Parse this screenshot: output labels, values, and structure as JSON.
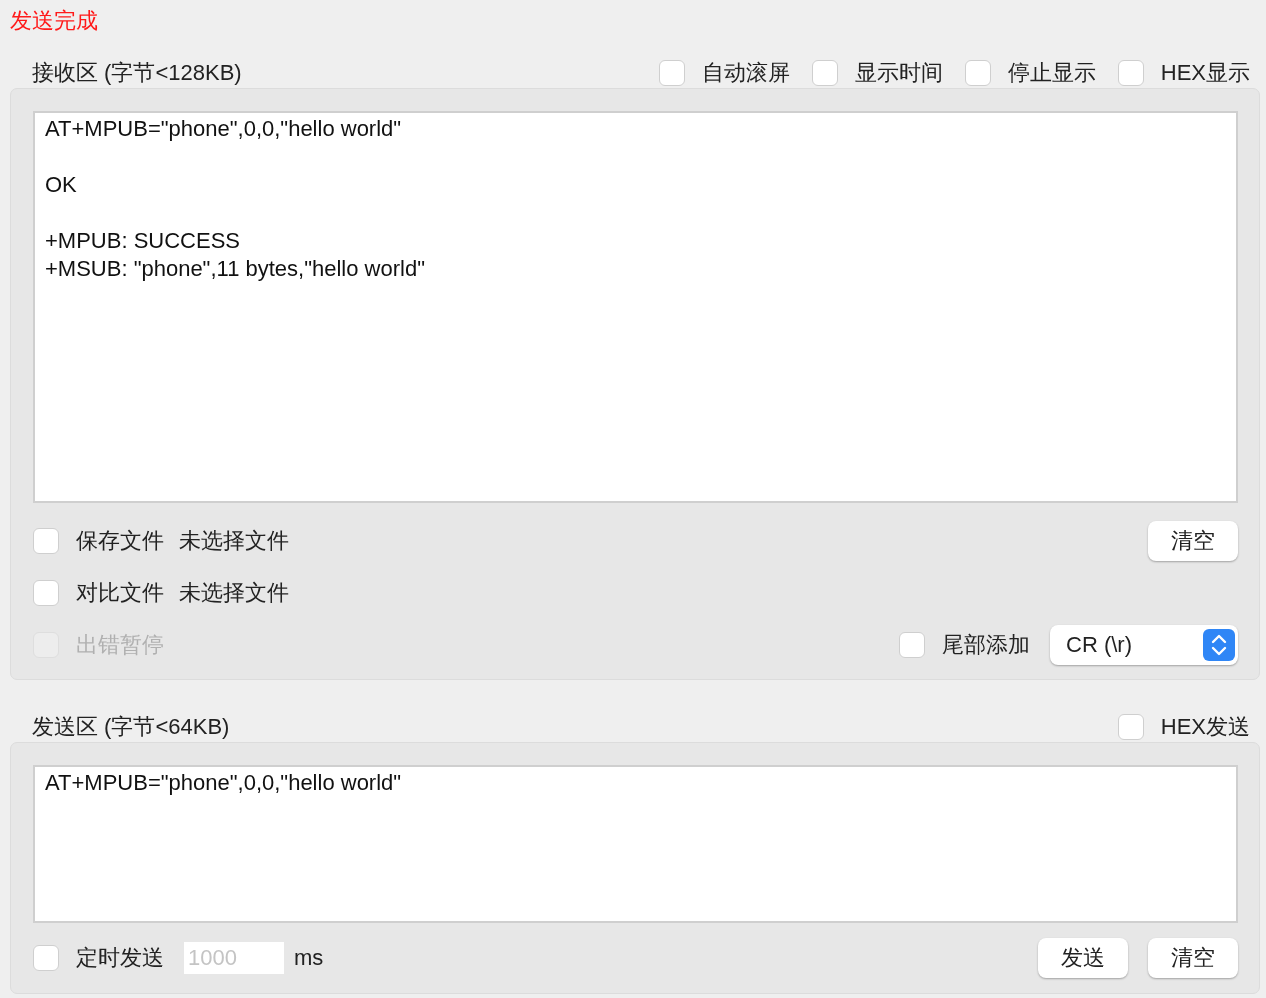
{
  "status": {
    "text": "发送完成"
  },
  "receive": {
    "title": "接收区 (字节<128KB)",
    "options": [
      {
        "label": "自动滚屏",
        "checked": false
      },
      {
        "label": "显示时间",
        "checked": false
      },
      {
        "label": "停止显示",
        "checked": false
      },
      {
        "label": "HEX显示",
        "checked": false
      }
    ],
    "content": "AT+MPUB=\"phone\",0,0,\"hello world\"\n\nOK\n\n+MPUB: SUCCESS\n+MSUB: \"phone\",11 bytes,\"hello world\"",
    "file_rows": [
      {
        "label": "保存文件",
        "file": "未选择文件",
        "checked": false,
        "disabled": false
      },
      {
        "label": "对比文件",
        "file": "未选择文件",
        "checked": false,
        "disabled": false
      },
      {
        "label": "出错暂停",
        "checked": false,
        "disabled": true
      }
    ],
    "clear_button": "清空",
    "append": {
      "label": "尾部添加",
      "checked": false
    },
    "line_ending": {
      "value": "CR (\\r)"
    }
  },
  "send": {
    "title": "发送区 (字节<64KB)",
    "hex": {
      "label": "HEX发送",
      "checked": false
    },
    "content": "AT+MPUB=\"phone\",0,0,\"hello world\"",
    "timer": {
      "label": "定时发送",
      "checked": false,
      "placeholder": "1000",
      "unit": "ms"
    },
    "buttons": [
      "发送",
      "清空"
    ]
  }
}
